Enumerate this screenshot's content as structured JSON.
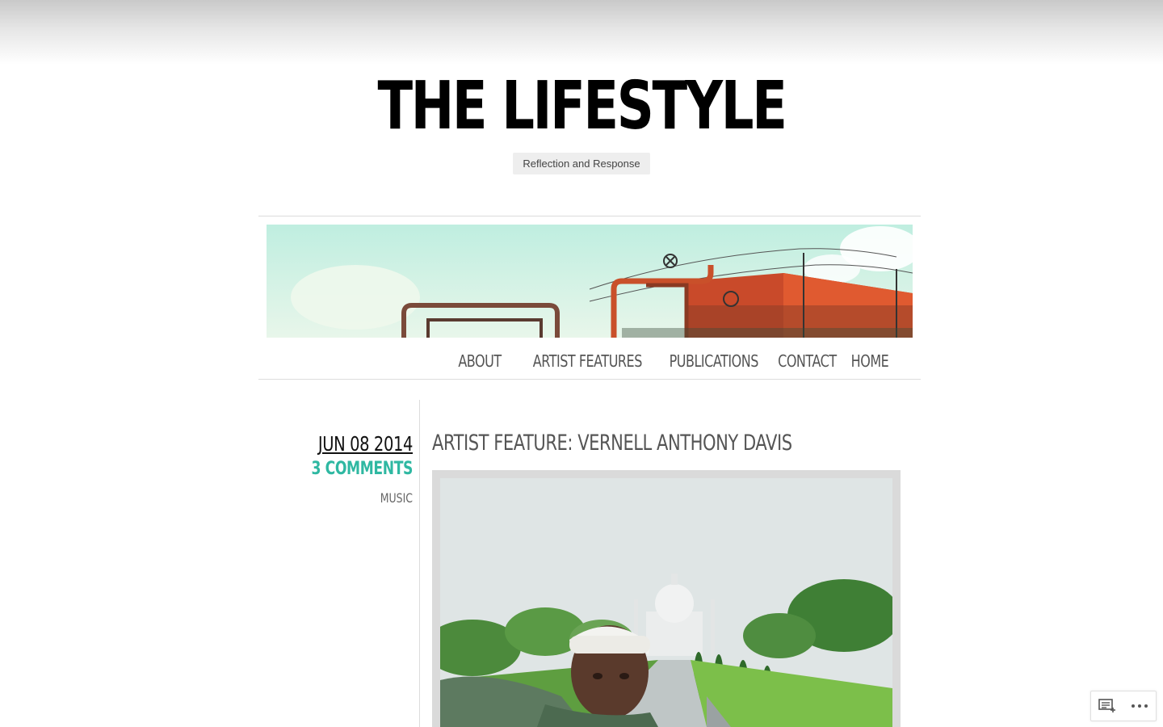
{
  "site": {
    "title": "THE LIFESTYLE",
    "tagline": "Reflection and Response"
  },
  "nav": {
    "items": [
      "ABOUT",
      "ARTIST FEATURES",
      "PUBLICATIONS",
      "CONTACT",
      "HOME"
    ]
  },
  "post": {
    "date": "JUN 08 2014",
    "comments": "3 COMMENTS",
    "category": "MUSIC",
    "title": "ARTIST FEATURE: VERNELL ANTHONY DAVIS"
  },
  "action_bar": {
    "follow_icon": "reader-follow-icon",
    "more_icon": "ellipsis-icon"
  },
  "colors": {
    "accent": "#2fb8a2",
    "nav_text": "#555555",
    "title_text": "#000000"
  }
}
